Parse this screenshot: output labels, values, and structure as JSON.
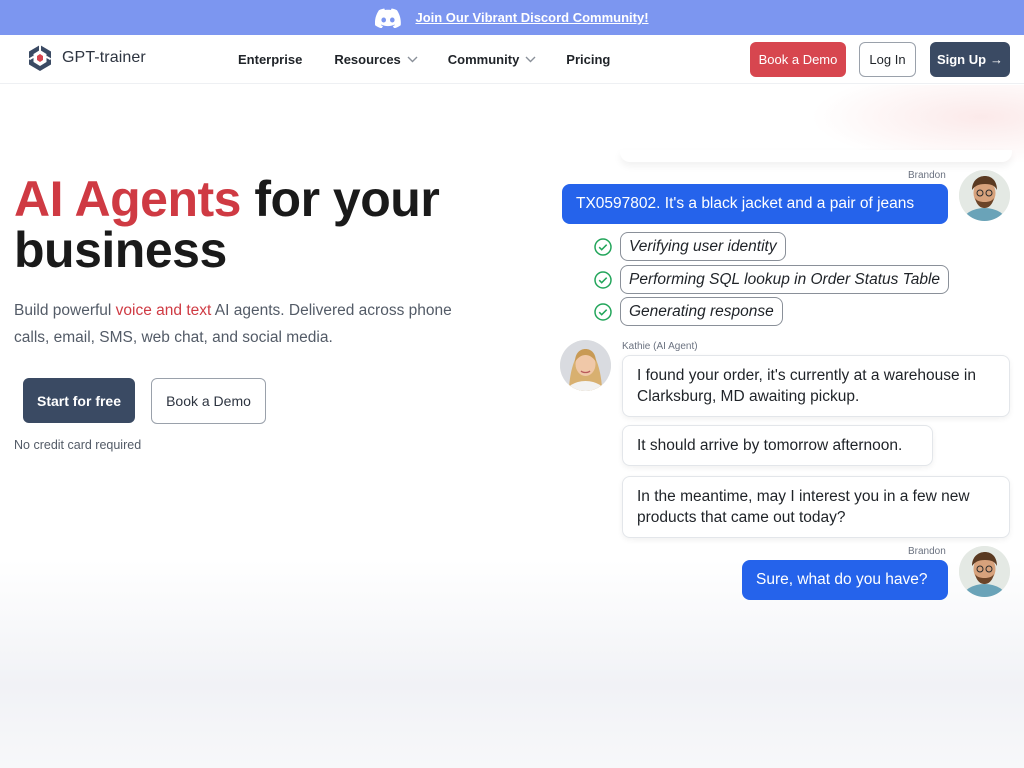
{
  "announcement": {
    "text": "Join Our Vibrant Discord Community!",
    "icon": "discord-icon"
  },
  "brand": {
    "name": "GPT-trainer",
    "icon": "gpt-trainer-logo-icon"
  },
  "nav": {
    "items": [
      {
        "label": "Enterprise",
        "dropdown": false
      },
      {
        "label": "Resources",
        "dropdown": true
      },
      {
        "label": "Community",
        "dropdown": true
      },
      {
        "label": "Pricing",
        "dropdown": false
      }
    ],
    "book_demo": "Book a Demo",
    "login": "Log In",
    "signup": "Sign Up",
    "signup_arrow": "→"
  },
  "hero": {
    "headline_accent": "AI Agents",
    "headline_rest_1": " for your",
    "headline_rest_2": "business",
    "sub_1": "Build powerful ",
    "sub_accent": "voice and text",
    "sub_2": " AI agents. Delivered across phone calls, email, SMS, web chat, and social media.",
    "cta_primary": "Start for free",
    "cta_secondary": "Book a Demo",
    "note": "No credit card required"
  },
  "chat": {
    "user_name": "Brandon",
    "agent_name": "Kathie (AI Agent)",
    "user_msg_1": "TX0597802. It's a black jacket and a pair of jeans",
    "steps": [
      "Verifying user identity",
      "Performing SQL lookup in Order Status Table",
      "Generating response"
    ],
    "agent_msgs": [
      "I found your order, it's currently at a warehouse in Clarksburg, MD awaiting pickup.",
      "It should arrive by tomorrow afternoon.",
      "In the meantime, may I interest you in a few new products that came out today?"
    ],
    "user_msg_2": "Sure, what do you have?"
  },
  "colors": {
    "announcement_bg": "#7c96f0",
    "accent_red": "#cf3a43",
    "primary_dark": "#3a4a63",
    "user_bubble": "#2563eb",
    "check_green": "#22a55a"
  }
}
